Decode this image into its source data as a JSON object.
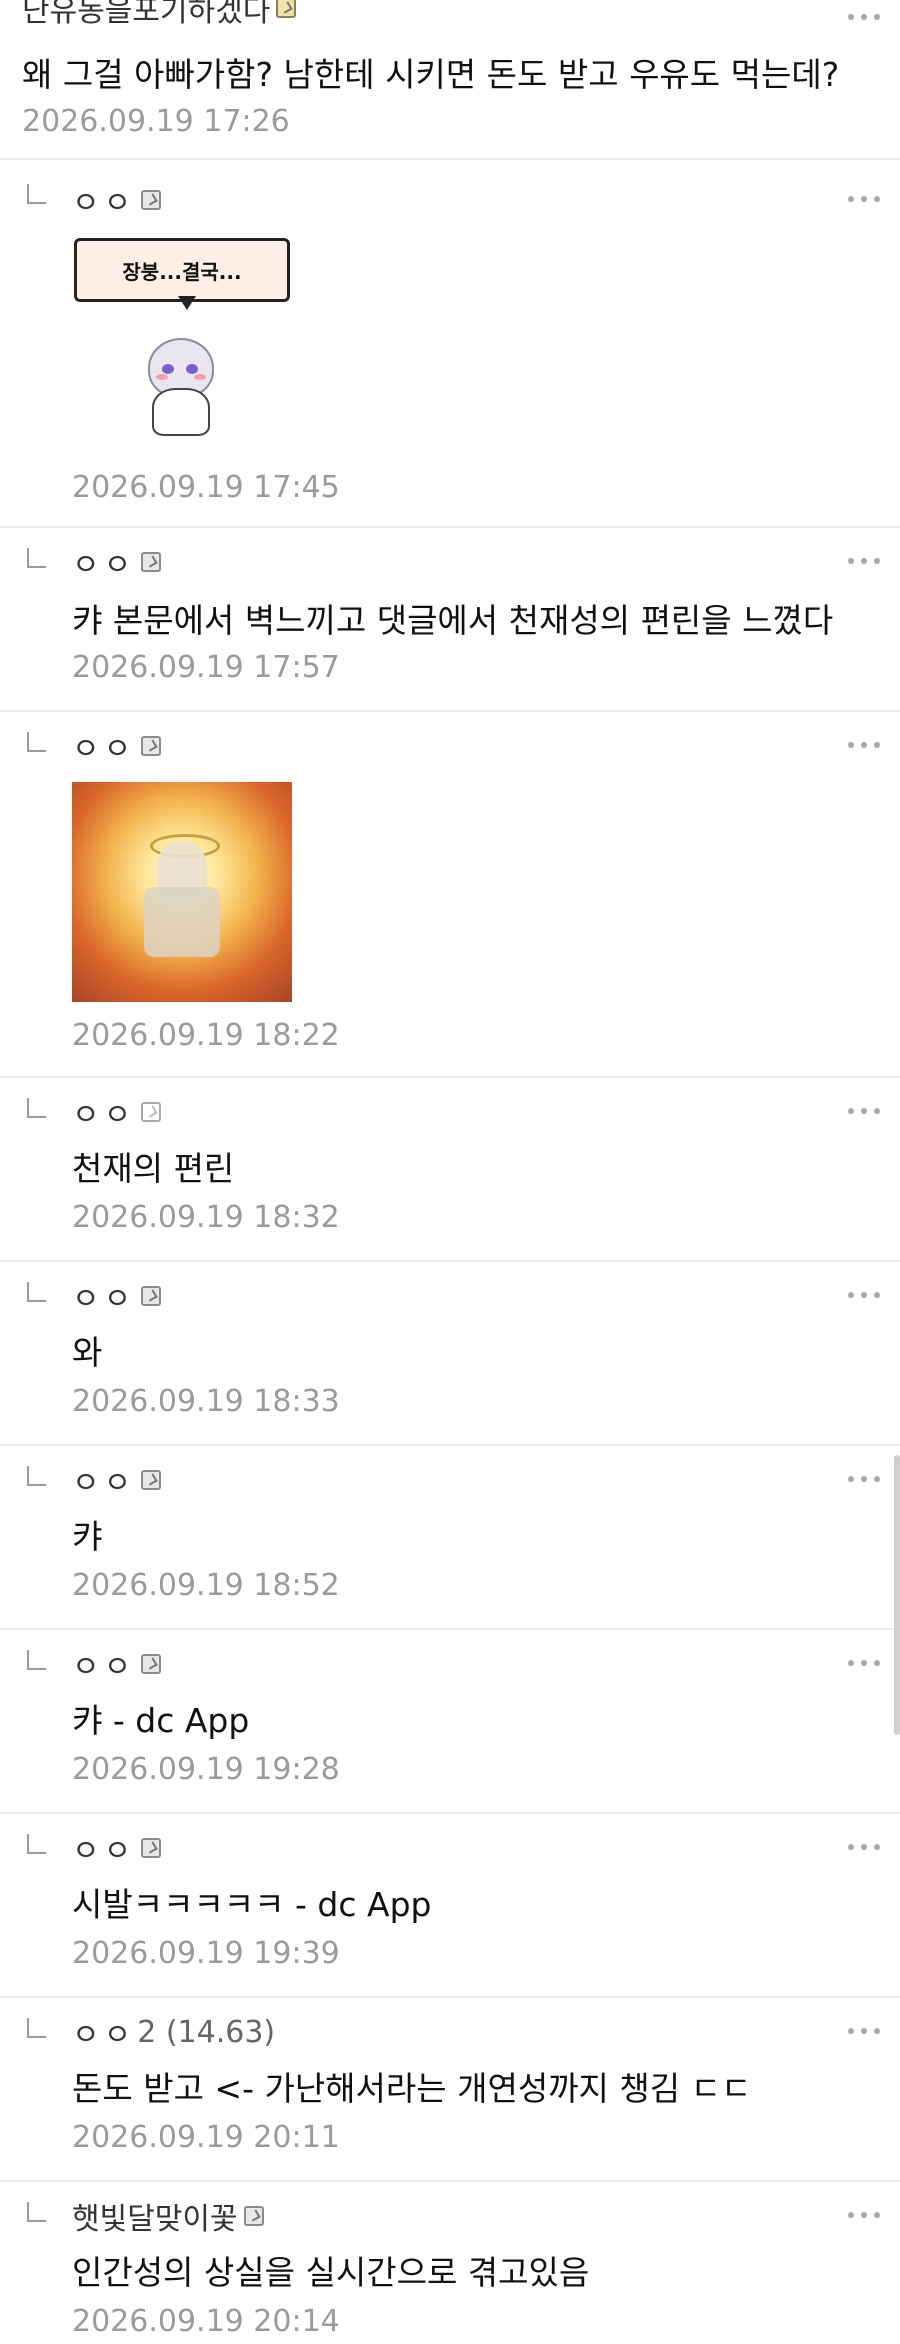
{
  "comments": [
    {
      "nick": "난유동을포기하겠다",
      "text": "왜 그걸 아빠가함? 남한테 시키면 돈도 받고 우유도 먹는데?",
      "time": "2026.09.19 17:26"
    },
    {
      "nick": "ㅇㅇ",
      "sticker_text": "장붕...결국...",
      "time": "2026.09.19 17:45"
    },
    {
      "nick": "ㅇㅇ",
      "text": "캬 본문에서 벽느끼고 댓글에서 천재성의 편린을 느꼈다",
      "time": "2026.09.19 17:57"
    },
    {
      "nick": "ㅇㅇ",
      "time": "2026.09.19 18:22"
    },
    {
      "nick": "ㅇㅇ",
      "text": "천재의 편린",
      "time": "2026.09.19 18:32"
    },
    {
      "nick": "ㅇㅇ",
      "text": "와",
      "time": "2026.09.19 18:33"
    },
    {
      "nick": "ㅇㅇ",
      "text": "캬",
      "time": "2026.09.19 18:52"
    },
    {
      "nick": "ㅇㅇ",
      "text": "캬 - dc App",
      "time": "2026.09.19 19:28"
    },
    {
      "nick": "ㅇㅇ",
      "text": "시발ㅋㅋㅋㅋㅋ - dc App",
      "time": "2026.09.19 19:39"
    },
    {
      "nick": "ㅇㅇ",
      "ip": "2 (14.63)",
      "text": "돈도 받고 <- 가난해서라는 개연성까지 챙김 ㄷㄷ",
      "time": "2026.09.19 20:11"
    },
    {
      "nick": "햇빛달맞이꽃",
      "text": "인간성의 상실을 실시간으로 겪고있음",
      "time": "2026.09.19 20:14"
    }
  ]
}
